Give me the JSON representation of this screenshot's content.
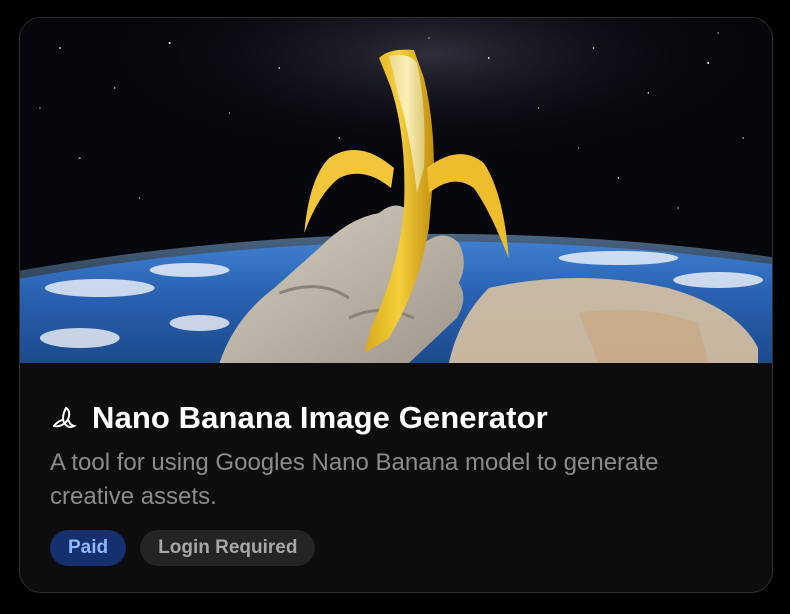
{
  "card": {
    "image_alt": "Astronaut gloved hand holding a peeled banana above Earth",
    "title_icon": "banana-icon",
    "title": "Nano Banana Image Generator",
    "description": "A tool for using Googles Nano Banana model to generate creative assets.",
    "tags": [
      {
        "label": "Paid"
      },
      {
        "label": "Login Required"
      }
    ]
  },
  "colors": {
    "background": "#000000",
    "card": "#0d0d0d",
    "paid_tag_bg": "#14306e",
    "paid_tag_text": "#8fb8ff",
    "login_tag_bg": "#242424",
    "login_tag_text": "#a8a8a8"
  }
}
